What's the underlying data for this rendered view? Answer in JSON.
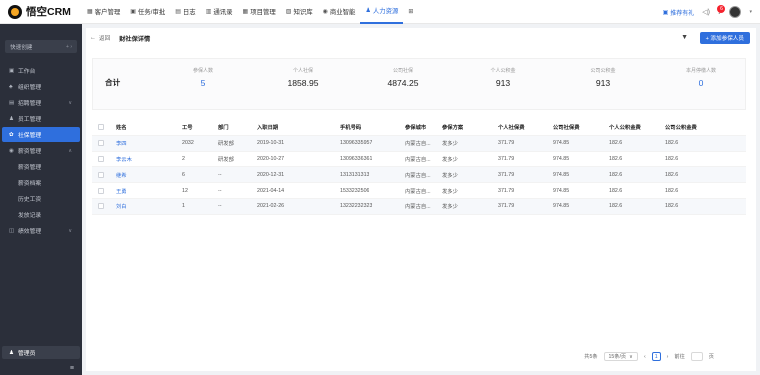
{
  "brand": {
    "name": "悟空CRM",
    "logo_icon": "crm-logo-icon"
  },
  "nav": {
    "items": [
      {
        "label": "客户管理",
        "icon": "▦",
        "active": false
      },
      {
        "label": "任务/审批",
        "icon": "▣",
        "active": false
      },
      {
        "label": "日志",
        "icon": "▤",
        "active": false
      },
      {
        "label": "通讯录",
        "icon": "▥",
        "active": false
      },
      {
        "label": "项目管理",
        "icon": "▦",
        "active": false
      },
      {
        "label": "知识库",
        "icon": "▧",
        "active": false
      },
      {
        "label": "商业智能",
        "icon": "◉",
        "active": false
      },
      {
        "label": "人力资源",
        "icon": "♟",
        "active": true
      },
      {
        "label": "",
        "icon": "⊞",
        "active": false
      }
    ]
  },
  "top_right": {
    "gift_label": "推荐有礼",
    "badge_count": "6"
  },
  "sidebar": {
    "quick_create": "快速创建",
    "items": [
      {
        "label": "工作台",
        "icon": "▣",
        "arrow": "",
        "active": false
      },
      {
        "label": "组织管理",
        "icon": "♣",
        "arrow": "",
        "active": false
      },
      {
        "label": "招聘管理",
        "icon": "▤",
        "arrow": "∨",
        "active": false
      },
      {
        "label": "员工管理",
        "icon": "♟",
        "arrow": "",
        "active": false
      },
      {
        "label": "社保管理",
        "icon": "✿",
        "arrow": "",
        "active": true
      },
      {
        "label": "薪资管理",
        "icon": "◉",
        "arrow": "∧",
        "active": false
      }
    ],
    "sub_items": [
      "薪资管理",
      "薪资档案",
      "历史工资",
      "发放记录"
    ],
    "performance": {
      "label": "绩效管理",
      "icon": "◫",
      "arrow": "∨"
    },
    "manage": {
      "label": "管理员",
      "icon": "♟"
    },
    "collapse_icon": "≡"
  },
  "page": {
    "back_label": "返回",
    "title": "财社保详情",
    "add_button": "+ 添加参保人员"
  },
  "summary": {
    "total_label": "合计",
    "stats": [
      {
        "label": "参保人数",
        "value": "5",
        "blue": true
      },
      {
        "label": "个人社保",
        "value": "1858.95",
        "blue": false
      },
      {
        "label": "公司社保",
        "value": "4874.25",
        "blue": false
      },
      {
        "label": "个人公积金",
        "value": "913",
        "blue": false
      },
      {
        "label": "公司公积金",
        "value": "913",
        "blue": false
      },
      {
        "label": "本月停缴人数",
        "value": "0",
        "blue": true
      }
    ]
  },
  "table": {
    "columns": [
      "姓名",
      "工号",
      "部门",
      "入职日期",
      "手机号码",
      "参保城市",
      "参保方案",
      "个人社保费",
      "公司社保费",
      "个人公积金费",
      "公司公积金费"
    ],
    "rows": [
      [
        "李四",
        "2032",
        "研发部",
        "2019-10-31",
        "13096335957",
        "内蒙古自...",
        "发多少",
        "371.79",
        "974.85",
        "182.6",
        "182.6"
      ],
      [
        "李云木",
        "2",
        "研发部",
        "2020-10-27",
        "13096336361",
        "内蒙古自...",
        "发多少",
        "371.79",
        "974.85",
        "182.6",
        "182.6"
      ],
      [
        "继希",
        "6",
        "--",
        "2020-12-31",
        "1313131313",
        "内蒙古自...",
        "发多少",
        "371.79",
        "974.85",
        "182.6",
        "182.6"
      ],
      [
        "王勇",
        "12",
        "--",
        "2021-04-14",
        "1533232506",
        "内蒙古自...",
        "发多少",
        "371.79",
        "974.85",
        "182.6",
        "182.6"
      ],
      [
        "刘白",
        "1",
        "--",
        "2021-02-26",
        "13232232323",
        "内蒙古自...",
        "发多少",
        "371.79",
        "974.85",
        "182.6",
        "182.6"
      ]
    ]
  },
  "pager": {
    "total": "共5条",
    "page_size": "15条/页",
    "current_page": "1",
    "goto_label": "前往",
    "page_suffix": "页"
  },
  "colors": {
    "accent": "#2f6fdd",
    "sidebar_bg": "#2b2f3a"
  }
}
